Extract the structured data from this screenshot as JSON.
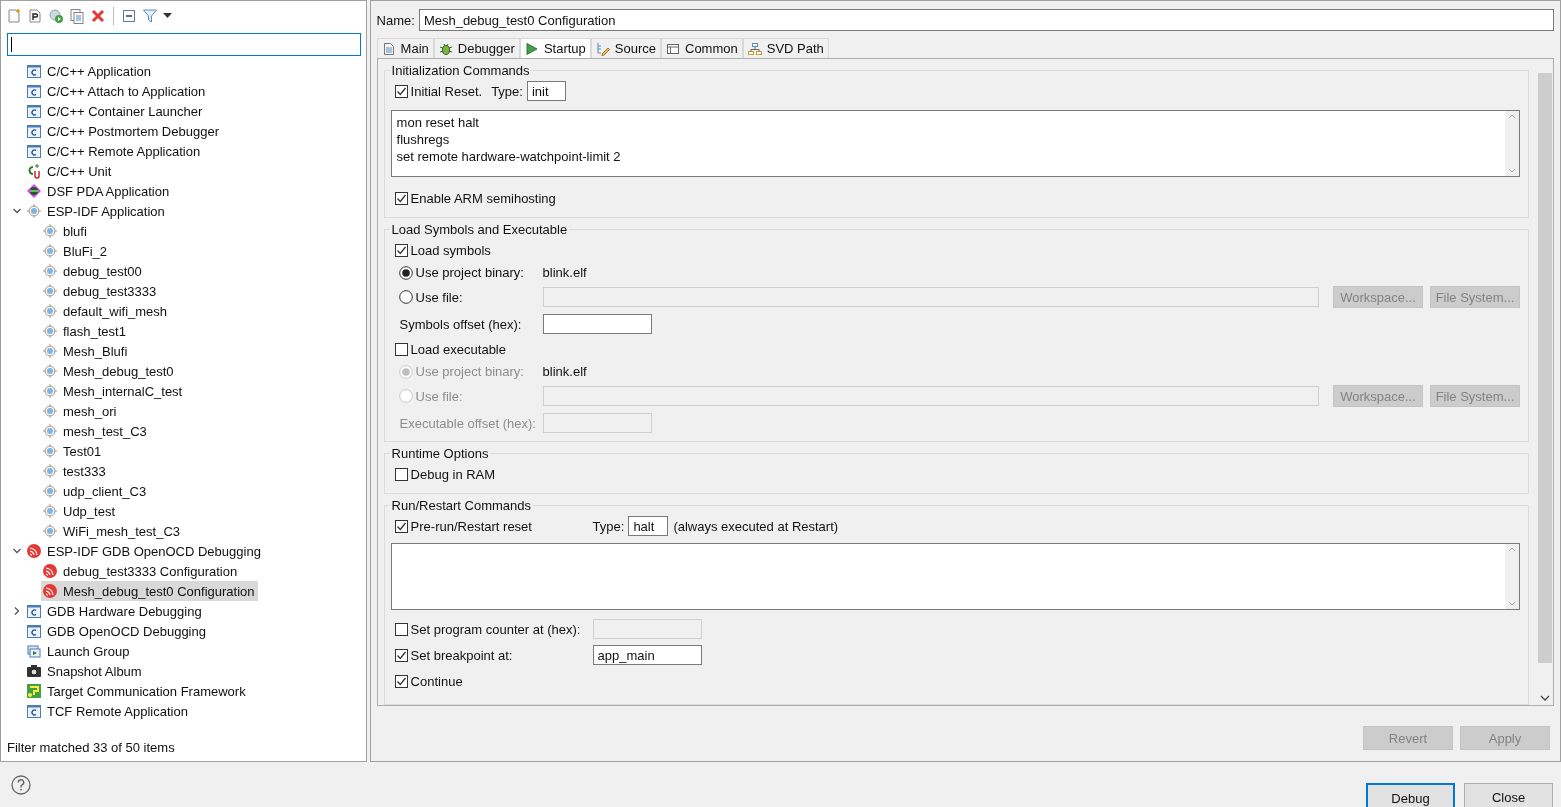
{
  "filter_field": {
    "focused": true
  },
  "tree": [
    {
      "label": "C/C++ Application",
      "kind": "c",
      "selected": false
    },
    {
      "label": "C/C++ Attach to Application",
      "kind": "c",
      "selected": false
    },
    {
      "label": "C/C++ Container Launcher",
      "kind": "c",
      "selected": false
    },
    {
      "label": "C/C++ Postmortem Debugger",
      "kind": "c",
      "selected": false
    },
    {
      "label": "C/C++ Remote Application",
      "kind": "c",
      "selected": false
    },
    {
      "label": "C/C++ Unit",
      "kind": "cunit",
      "selected": false
    },
    {
      "label": "DSF PDA Application",
      "kind": "dsf",
      "selected": false
    },
    {
      "label": "ESP-IDF Application",
      "kind": "target",
      "selected": false,
      "expanded": true,
      "children": [
        {
          "label": "blufi",
          "kind": "target",
          "selected": false
        },
        {
          "label": "BluFi_2",
          "kind": "target",
          "selected": false
        },
        {
          "label": "debug_test00",
          "kind": "target",
          "selected": false
        },
        {
          "label": "debug_test3333",
          "kind": "target",
          "selected": false
        },
        {
          "label": "default_wifi_mesh",
          "kind": "target",
          "selected": false
        },
        {
          "label": "flash_test1",
          "kind": "target",
          "selected": false
        },
        {
          "label": "Mesh_Blufi",
          "kind": "target",
          "selected": false
        },
        {
          "label": "Mesh_debug_test0",
          "kind": "target",
          "selected": false
        },
        {
          "label": "Mesh_internalC_test",
          "kind": "target",
          "selected": false
        },
        {
          "label": "mesh_ori",
          "kind": "target",
          "selected": false
        },
        {
          "label": "mesh_test_C3",
          "kind": "target",
          "selected": false
        },
        {
          "label": "Test01",
          "kind": "target",
          "selected": false
        },
        {
          "label": "test333",
          "kind": "target",
          "selected": false
        },
        {
          "label": "udp_client_C3",
          "kind": "target",
          "selected": false
        },
        {
          "label": "Udp_test",
          "kind": "target",
          "selected": false
        },
        {
          "label": "WiFi_mesh_test_C3",
          "kind": "target",
          "selected": false
        }
      ]
    },
    {
      "label": "ESP-IDF GDB OpenOCD Debugging",
      "kind": "esp",
      "selected": false,
      "expanded": true,
      "children": [
        {
          "label": "debug_test3333 Configuration",
          "kind": "esp",
          "selected": false
        },
        {
          "label": "Mesh_debug_test0 Configuration",
          "kind": "esp",
          "selected": true
        }
      ]
    },
    {
      "label": "GDB Hardware Debugging",
      "kind": "c",
      "selected": false,
      "expanded": false
    },
    {
      "label": "GDB OpenOCD Debugging",
      "kind": "c",
      "selected": false
    },
    {
      "label": "Launch Group",
      "kind": "launch-group",
      "selected": false
    },
    {
      "label": "Snapshot Album",
      "kind": "camera",
      "selected": false
    },
    {
      "label": "Target Communication Framework",
      "kind": "tcf",
      "selected": false
    },
    {
      "label": "TCF Remote Application",
      "kind": "c",
      "selected": false
    }
  ],
  "filter_status": "Filter matched 33 of 50 items",
  "name": {
    "label": "Name:",
    "value": "Mesh_debug_test0 Configuration"
  },
  "tabs": [
    {
      "label": "Main",
      "kind": "main",
      "selected": false
    },
    {
      "label": "Debugger",
      "kind": "debugger",
      "selected": false
    },
    {
      "label": "Startup",
      "kind": "startup",
      "selected": true
    },
    {
      "label": "Source",
      "kind": "source",
      "selected": false
    },
    {
      "label": "Common",
      "kind": "common",
      "selected": false
    },
    {
      "label": "SVD Path",
      "kind": "svd",
      "selected": false
    }
  ],
  "initialization": {
    "title": "Initialization Commands",
    "initial_reset": {
      "label": "Initial Reset.",
      "checked": true
    },
    "type_label": "Type:",
    "type_value": "init",
    "commands": [
      "mon reset halt",
      "flushregs",
      "set remote hardware-watchpoint-limit 2"
    ],
    "semihosting": {
      "label": "Enable ARM semihosting",
      "checked": true
    }
  },
  "load": {
    "title": "Load Symbols and Executable",
    "load_symbols": {
      "label": "Load symbols",
      "checked": true
    },
    "symbols_source": [
      {
        "label": "Use project binary:",
        "selected": true,
        "value": "blink.elf"
      },
      {
        "label": "Use file:",
        "selected": false
      }
    ],
    "symbols_buttons": [
      "Workspace...",
      "File System..."
    ],
    "symbols_offset": "Symbols offset (hex):",
    "load_executable": {
      "label": "Load executable",
      "checked": false
    },
    "executable_source": [
      {
        "label": "Use project binary:",
        "selected": true,
        "value": "blink.elf"
      },
      {
        "label": "Use file:",
        "selected": false
      }
    ],
    "executable_buttons": [
      "Workspace...",
      "File System..."
    ],
    "executable_offset": "Executable offset (hex):"
  },
  "runtime": {
    "title": "Runtime Options",
    "debug_in_ram": {
      "label": "Debug in RAM",
      "checked": false
    }
  },
  "run": {
    "title": "Run/Restart Commands",
    "pre_run_reset": {
      "label": "Pre-run/Restart reset",
      "checked": true
    },
    "type_label": "Type:",
    "type_value": "halt",
    "note": "(always executed at Restart)",
    "program_counter": {
      "label": "Set program counter at (hex):",
      "checked": false
    },
    "breakpoint": {
      "label": "Set breakpoint at:",
      "checked": true,
      "value": "app_main"
    },
    "continue": {
      "label": "Continue",
      "checked": true
    }
  },
  "actions": [
    {
      "label": "Revert",
      "disabled": true
    },
    {
      "label": "Apply",
      "disabled": true
    }
  ],
  "dialog_buttons": [
    {
      "label": "Debug",
      "default": true
    },
    {
      "label": "Close",
      "default": false
    }
  ]
}
